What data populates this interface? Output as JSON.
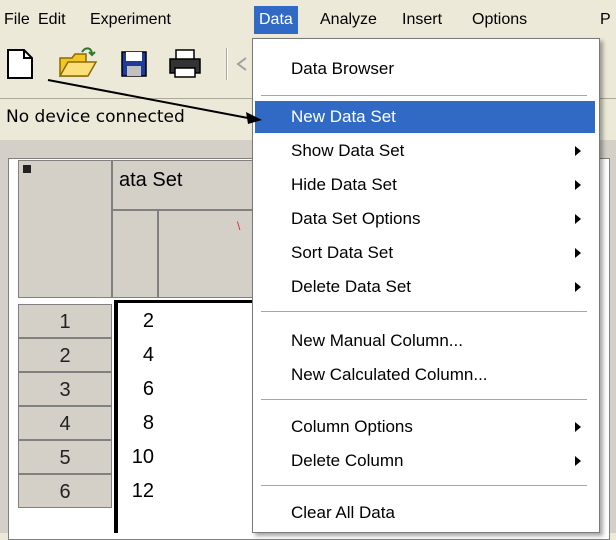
{
  "menubar": {
    "items": [
      "File",
      "Edit",
      "Experiment",
      "Data",
      "Analyze",
      "Insert",
      "Options",
      "P"
    ]
  },
  "status": {
    "text": "No device connected"
  },
  "table": {
    "header_text": "ata Set",
    "rows": [
      {
        "num": "1",
        "value": "2"
      },
      {
        "num": "2",
        "value": "4"
      },
      {
        "num": "3",
        "value": "6"
      },
      {
        "num": "4",
        "value": "8"
      },
      {
        "num": "5",
        "value": "10"
      },
      {
        "num": "6",
        "value": "12"
      }
    ]
  },
  "data_menu": {
    "items": [
      {
        "label": "Data Browser",
        "submenu": false
      },
      {
        "label": "New Data Set",
        "submenu": false,
        "selected": true
      },
      {
        "label": "Show Data Set",
        "submenu": true
      },
      {
        "label": "Hide Data Set",
        "submenu": true
      },
      {
        "label": "Data Set Options",
        "submenu": true
      },
      {
        "label": "Sort Data Set",
        "submenu": true
      },
      {
        "label": "Delete Data Set",
        "submenu": true
      },
      {
        "label": "New Manual Column...",
        "submenu": false
      },
      {
        "label": "New Calculated Column...",
        "submenu": false
      },
      {
        "label": "Column Options",
        "submenu": true
      },
      {
        "label": "Delete Column",
        "submenu": true
      },
      {
        "label": "Clear All Data",
        "submenu": false
      }
    ]
  },
  "colors": {
    "selection": "#316ac5",
    "annotation_arrow": "#000000"
  }
}
